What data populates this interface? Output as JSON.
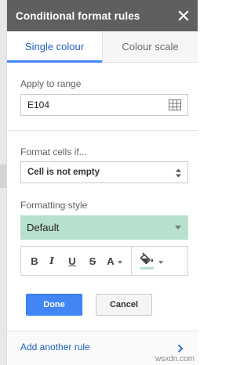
{
  "header": {
    "title": "Conditional format rules",
    "close_icon": "close-icon"
  },
  "tabs": [
    {
      "label": "Single colour",
      "active": true
    },
    {
      "label": "Colour scale",
      "active": false
    }
  ],
  "range": {
    "label": "Apply to range",
    "value": "E104",
    "icon": "grid-icon"
  },
  "format": {
    "label": "Format cells if...",
    "selected": "Cell is not empty"
  },
  "style": {
    "label": "Formatting style",
    "selected": "Default",
    "fill_color": "#b7e1cd"
  },
  "toolbar": {
    "bold": "B",
    "italic": "I",
    "underline": "U",
    "strikethrough": "S",
    "text_color": "A"
  },
  "actions": {
    "done": "Done",
    "cancel": "Cancel"
  },
  "footer": {
    "add_rule": "Add another rule"
  },
  "watermark": "wsxdn.com",
  "colors": {
    "header_bg": "#5f5f5f",
    "accent": "#4285f4",
    "link": "#1f5fbf",
    "style_fill": "#b7e1cd"
  }
}
